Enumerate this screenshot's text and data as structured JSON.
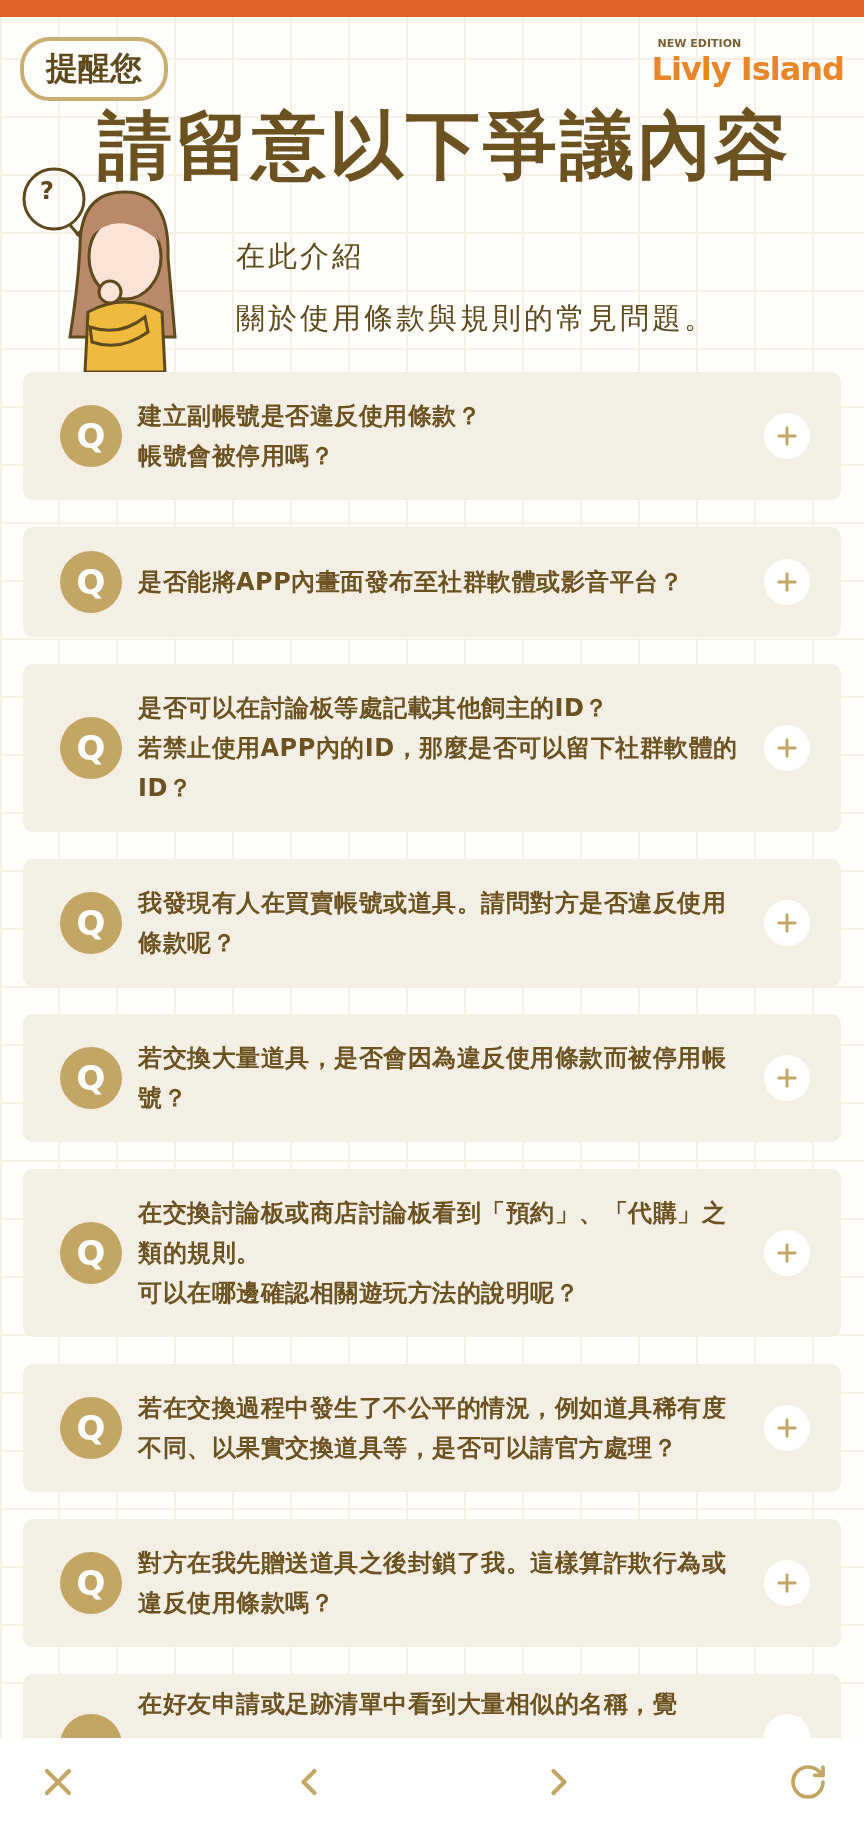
{
  "header": {
    "badge": "提醒您",
    "logo": {
      "edition": "NEW EDITION",
      "name": "Livly Island"
    },
    "title": "請留意以下爭議內容",
    "bubble": "?",
    "subtitle": [
      "在此介紹",
      "關於使用條款與規則的常見問題。"
    ]
  },
  "faq": [
    {
      "marker": "Q",
      "question": [
        "建立副帳號是否違反使用條款？",
        "帳號會被停用嗎？"
      ],
      "expanded": false
    },
    {
      "marker": "Q",
      "question": [
        "是否能將APP內畫面發布至社群軟體或影音平台？"
      ],
      "expanded": false
    },
    {
      "marker": "Q",
      "question": [
        "是否可以在討論板等處記載其他飼主的ID？",
        "若禁止使用APP內的ID，那麼是否可以留下社群軟體的ID？"
      ],
      "expanded": false
    },
    {
      "marker": "Q",
      "question": [
        "我發現有人在買賣帳號或道具。請問對方是否違反使用條款呢？"
      ],
      "expanded": false
    },
    {
      "marker": "Q",
      "question": [
        "若交換大量道具，是否會因為違反使用條款而被停用帳號？"
      ],
      "expanded": false
    },
    {
      "marker": "Q",
      "question": [
        "在交換討論板或商店討論板看到「預約」、「代購」之類的規則。",
        "可以在哪邊確認相關遊玩方法的說明呢？"
      ],
      "expanded": false
    },
    {
      "marker": "Q",
      "question": [
        "若在交換過程中發生了不公平的情況，例如道具稀有度不同、以果實交換道具等，是否可以請官方處理？"
      ],
      "expanded": false
    },
    {
      "marker": "Q",
      "question": [
        "對方在我先贈送道具之後封鎖了我。這樣算詐欺行為或違反使用條款嗎？"
      ],
      "expanded": false
    },
    {
      "kind": "partial",
      "question": [
        "在好友申請或足跡清單中看到大量相似的名稱，覺"
      ]
    }
  ]
}
